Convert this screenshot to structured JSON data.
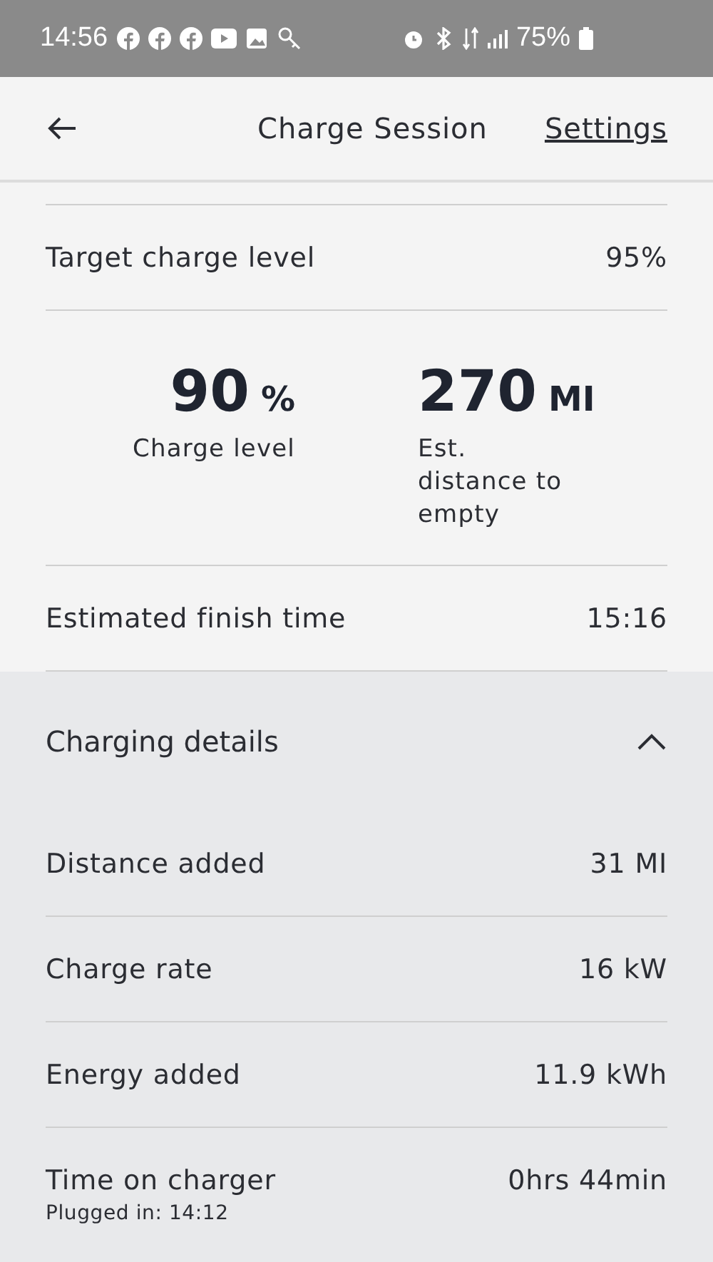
{
  "status_bar": {
    "time": "14:56",
    "battery": "75%"
  },
  "header": {
    "title": "Charge Session",
    "settings_link": "Settings"
  },
  "target": {
    "label": "Target charge level",
    "value": "95%"
  },
  "stats": [
    {
      "number": "90",
      "unit": "%",
      "label": "Charge level"
    },
    {
      "number": "270",
      "unit": "MI",
      "label": "Est. distance to empty"
    }
  ],
  "finish": {
    "label": "Estimated finish time",
    "value": "15:16"
  },
  "details": {
    "title": "Charging details",
    "expanded": true,
    "rows": [
      {
        "label": "Distance added",
        "value": "31 MI"
      },
      {
        "label": "Charge rate",
        "value": "16 kW"
      },
      {
        "label": "Energy added",
        "value": "11.9 kWh"
      },
      {
        "label": "Time on charger",
        "value": "0hrs 44min",
        "note": "Plugged in: 14:12"
      }
    ]
  }
}
